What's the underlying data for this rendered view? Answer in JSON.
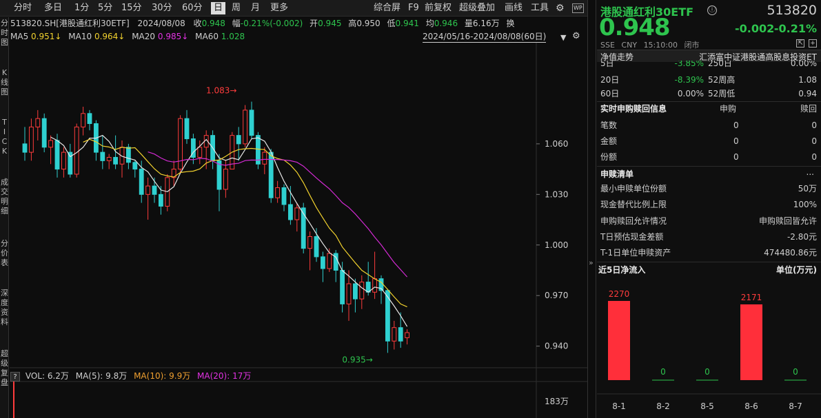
{
  "toolbar": {
    "left": [
      "分时",
      "多日",
      "1分",
      "5分",
      "15分",
      "30分",
      "60分",
      "日",
      "周",
      "月",
      "更多"
    ],
    "active": "日",
    "right": [
      "综合屏",
      "F9",
      "前复权",
      "超级叠加",
      "画线",
      "工具"
    ],
    "gear_icon": "gear-icon",
    "app_icon": "WP"
  },
  "leftbar": [
    "分\n时\n图",
    "K\n线\n图",
    "T\nI\nC\nK",
    "成\n交\n明\n细",
    "分\n价\n表",
    "深\n度\n资\n料",
    "超\n级\n复\n盘"
  ],
  "info": {
    "symbol": "513820.SH[港股通红利30ETF]",
    "date": "2024/08/08",
    "close_label": "收",
    "close": "0.948",
    "amp_label": "幅",
    "amp": "-0.21%(-0.002)",
    "open_label": "开",
    "open": "0.945",
    "high_label": "高",
    "high": "0.950",
    "low_label": "低",
    "low": "0.941",
    "avg_label": "均",
    "avg": "0.946",
    "vol_label": "量",
    "vol": "6.16万",
    "turn_label": "换"
  },
  "ma": {
    "ma5": "MA5",
    "ma5_val": "0.951↓",
    "ma10": "MA10",
    "ma10_val": "0.964↓",
    "ma20": "MA20",
    "ma20_val": "0.985↓",
    "ma60": "MA60",
    "ma60_val": "1.028"
  },
  "range": "2024/05/16-2024/08/08(60日)",
  "volume_bar": {
    "q": "?",
    "vol": "VOL: 6.2万",
    "ma5": "MA(5): 9.8万",
    "ma10": "MA(10): 9.9万",
    "ma20": "MA(20): 17万"
  },
  "chart_data": {
    "type": "candlestick",
    "y_ticks": [
      "1.060",
      "1.030",
      "1.000",
      "0.970",
      "0.940"
    ],
    "ylim": [
      0.928,
      1.12
    ],
    "vol_tick": "183万",
    "max_label": "1.083",
    "min_label": "0.935",
    "candles": [
      {
        "o": 1.06,
        "h": 1.07,
        "l": 1.05,
        "c": 1.055
      },
      {
        "o": 1.055,
        "h": 1.075,
        "l": 1.05,
        "c": 1.07
      },
      {
        "o": 1.07,
        "h": 1.08,
        "l": 1.062,
        "c": 1.075
      },
      {
        "o": 1.075,
        "h": 1.078,
        "l": 1.055,
        "c": 1.058
      },
      {
        "o": 1.058,
        "h": 1.065,
        "l": 1.048,
        "c": 1.062
      },
      {
        "o": 1.062,
        "h": 1.066,
        "l": 1.04,
        "c": 1.045
      },
      {
        "o": 1.045,
        "h": 1.058,
        "l": 1.04,
        "c": 1.055
      },
      {
        "o": 1.055,
        "h": 1.06,
        "l": 1.04,
        "c": 1.042
      },
      {
        "o": 1.042,
        "h": 1.072,
        "l": 1.04,
        "c": 1.07
      },
      {
        "o": 1.07,
        "h": 1.082,
        "l": 1.065,
        "c": 1.078
      },
      {
        "o": 1.078,
        "h": 1.08,
        "l": 1.068,
        "c": 1.072
      },
      {
        "o": 1.072,
        "h": 1.074,
        "l": 1.05,
        "c": 1.055
      },
      {
        "o": 1.055,
        "h": 1.065,
        "l": 1.045,
        "c": 1.05
      },
      {
        "o": 1.05,
        "h": 1.054,
        "l": 1.045,
        "c": 1.052
      },
      {
        "o": 1.052,
        "h": 1.065,
        "l": 1.045,
        "c": 1.048
      },
      {
        "o": 1.048,
        "h": 1.062,
        "l": 1.04,
        "c": 1.058
      },
      {
        "o": 1.058,
        "h": 1.06,
        "l": 1.045,
        "c": 1.049
      },
      {
        "o": 1.049,
        "h": 1.05,
        "l": 1.04,
        "c": 1.045
      },
      {
        "o": 1.045,
        "h": 1.05,
        "l": 1.025,
        "c": 1.03
      },
      {
        "o": 1.03,
        "h": 1.04,
        "l": 1.015,
        "c": 1.035
      },
      {
        "o": 1.035,
        "h": 1.04,
        "l": 1.025,
        "c": 1.03
      },
      {
        "o": 1.03,
        "h": 1.035,
        "l": 1.018,
        "c": 1.023
      },
      {
        "o": 1.023,
        "h": 1.042,
        "l": 1.02,
        "c": 1.04
      },
      {
        "o": 1.04,
        "h": 1.05,
        "l": 1.035,
        "c": 1.045
      },
      {
        "o": 1.045,
        "h": 1.077,
        "l": 1.043,
        "c": 1.075
      },
      {
        "o": 1.075,
        "h": 1.08,
        "l": 1.06,
        "c": 1.063
      },
      {
        "o": 1.063,
        "h": 1.066,
        "l": 1.048,
        "c": 1.052
      },
      {
        "o": 1.052,
        "h": 1.062,
        "l": 1.048,
        "c": 1.058
      },
      {
        "o": 1.058,
        "h": 1.068,
        "l": 1.045,
        "c": 1.065
      },
      {
        "o": 1.065,
        "h": 1.068,
        "l": 1.045,
        "c": 1.05
      },
      {
        "o": 1.05,
        "h": 1.054,
        "l": 1.02,
        "c": 1.033
      },
      {
        "o": 1.033,
        "h": 1.05,
        "l": 1.028,
        "c": 1.045
      },
      {
        "o": 1.045,
        "h": 1.067,
        "l": 1.045,
        "c": 1.065
      },
      {
        "o": 1.065,
        "h": 1.07,
        "l": 1.05,
        "c": 1.06
      },
      {
        "o": 1.06,
        "h": 1.083,
        "l": 1.058,
        "c": 1.08
      },
      {
        "o": 1.08,
        "h": 1.085,
        "l": 1.063,
        "c": 1.065
      },
      {
        "o": 1.065,
        "h": 1.067,
        "l": 1.045,
        "c": 1.048
      },
      {
        "o": 1.048,
        "h": 1.058,
        "l": 1.042,
        "c": 1.055
      },
      {
        "o": 1.055,
        "h": 1.057,
        "l": 1.025,
        "c": 1.028
      },
      {
        "o": 1.028,
        "h": 1.038,
        "l": 1.025,
        "c": 1.034
      },
      {
        "o": 1.034,
        "h": 1.036,
        "l": 1.02,
        "c": 1.024
      },
      {
        "o": 1.024,
        "h": 1.035,
        "l": 1.012,
        "c": 1.015
      },
      {
        "o": 1.015,
        "h": 1.025,
        "l": 1.008,
        "c": 1.022
      },
      {
        "o": 1.022,
        "h": 1.025,
        "l": 0.995,
        "c": 0.998
      },
      {
        "o": 0.998,
        "h": 1.008,
        "l": 0.985,
        "c": 1.005
      },
      {
        "o": 1.005,
        "h": 1.01,
        "l": 0.99,
        "c": 0.993
      },
      {
        "o": 0.993,
        "h": 0.996,
        "l": 0.978,
        "c": 0.986
      },
      {
        "o": 0.986,
        "h": 0.998,
        "l": 0.984,
        "c": 0.995
      },
      {
        "o": 0.995,
        "h": 0.997,
        "l": 0.978,
        "c": 0.985
      },
      {
        "o": 0.985,
        "h": 0.99,
        "l": 0.96,
        "c": 0.965
      },
      {
        "o": 0.965,
        "h": 0.985,
        "l": 0.955,
        "c": 0.977
      },
      {
        "o": 0.977,
        "h": 0.98,
        "l": 0.96,
        "c": 0.968
      },
      {
        "o": 0.968,
        "h": 0.982,
        "l": 0.962,
        "c": 0.978
      },
      {
        "o": 0.978,
        "h": 0.99,
        "l": 0.97,
        "c": 0.972
      },
      {
        "o": 0.972,
        "h": 0.996,
        "l": 0.968,
        "c": 0.98
      },
      {
        "o": 0.98,
        "h": 0.982,
        "l": 0.965,
        "c": 0.973
      },
      {
        "o": 0.973,
        "h": 0.974,
        "l": 0.936,
        "c": 0.943
      },
      {
        "o": 0.943,
        "h": 0.955,
        "l": 0.938,
        "c": 0.951
      },
      {
        "o": 0.951,
        "h": 0.96,
        "l": 0.939,
        "c": 0.943
      },
      {
        "o": 0.945,
        "h": 0.95,
        "l": 0.941,
        "c": 0.948
      }
    ]
  },
  "right": {
    "name": "港股通红利30ETF",
    "info_icon": "ⓘ",
    "code": "513820",
    "price": "0.948",
    "change": "-0.002",
    "change_pct": "-0.21%",
    "market": "SSE",
    "currency": "CNY",
    "time": "15:10:00",
    "status": "闭市",
    "nav_label": "净值走势",
    "fund_full": "汇添富中证港股通高股息投资ET",
    "perf": [
      {
        "k1": "5日",
        "v1": "-3.85%",
        "k2": "250日",
        "v2": "0.00%"
      },
      {
        "k1": "20日",
        "v1": "-8.39%",
        "k2": "52周高",
        "v2": "1.08"
      },
      {
        "k1": "60日",
        "v1": "0.00%",
        "k2": "52周低",
        "v2": "0.94"
      }
    ],
    "redeem_title": "实时申购赎回信息",
    "redeem_col1": "申购",
    "redeem_col2": "赎回",
    "redeem_rows": [
      {
        "k": "笔数",
        "a": "0",
        "b": "0"
      },
      {
        "k": "金额",
        "a": "0",
        "b": "0"
      },
      {
        "k": "份额",
        "a": "0",
        "b": "0"
      }
    ],
    "list_title": "申赎清单",
    "list_more": "...",
    "list_rows": [
      {
        "k": "最小申赎单位份额",
        "v": "50万"
      },
      {
        "k": "现金替代比例上限",
        "v": "100%"
      },
      {
        "k": "申购赎回允许情况",
        "v": "申购赎回皆允许"
      },
      {
        "k": "T日预估现金差额",
        "v": "-2.80元"
      },
      {
        "k": "T-1日单位申赎资产",
        "v": "474480.86元"
      }
    ],
    "flow_title": "近5日净流入",
    "flow_unit": "单位(万元)",
    "splitter": "»"
  },
  "flow_chart": {
    "type": "bar",
    "categories": [
      "8-1",
      "8-2",
      "8-5",
      "8-6",
      "8-7"
    ],
    "values": [
      2270,
      0,
      0,
      2171,
      0
    ],
    "labels": [
      "2270",
      "0",
      "0",
      "2171",
      "0"
    ]
  }
}
